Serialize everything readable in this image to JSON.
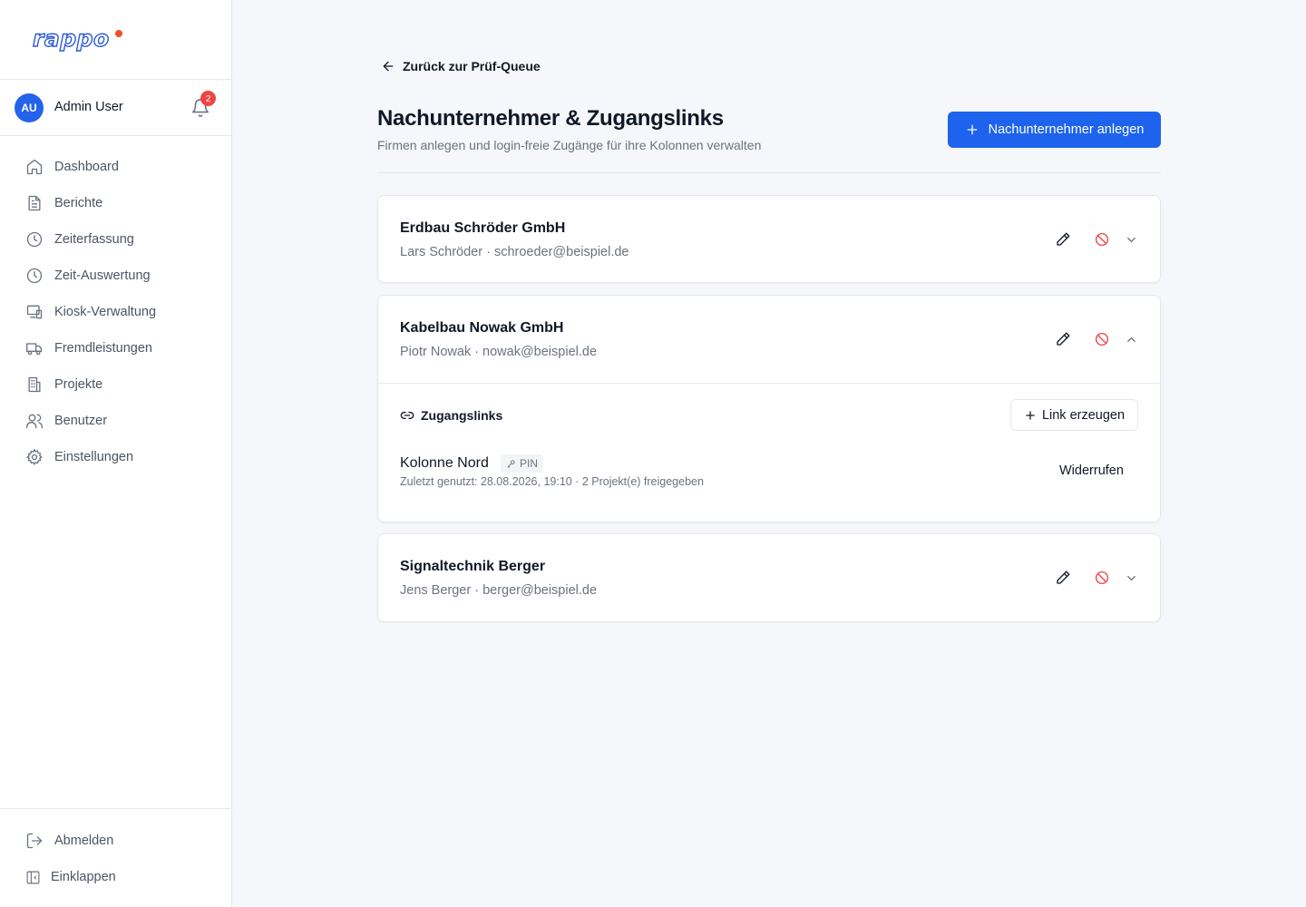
{
  "brand": {
    "logo_text": "rappo",
    "dot_color": "#f04e23"
  },
  "user": {
    "initials": "AU",
    "name": "Admin User",
    "notifications": "2"
  },
  "nav": {
    "items": [
      {
        "label": "Dashboard",
        "icon": "home-icon"
      },
      {
        "label": "Berichte",
        "icon": "document-icon"
      },
      {
        "label": "Zeiterfassung",
        "icon": "clock-icon"
      },
      {
        "label": "Zeit-Auswertung",
        "icon": "clock-icon"
      },
      {
        "label": "Kiosk-Verwaltung",
        "icon": "devices-icon"
      },
      {
        "label": "Fremdleistungen",
        "icon": "truck-icon"
      },
      {
        "label": "Projekte",
        "icon": "building-icon"
      },
      {
        "label": "Benutzer",
        "icon": "users-icon"
      },
      {
        "label": "Einstellungen",
        "icon": "gear-icon"
      }
    ],
    "bottom": [
      {
        "label": "Abmelden",
        "icon": "logout-icon"
      },
      {
        "label": "Einklappen",
        "icon": "collapse-icon"
      }
    ]
  },
  "page": {
    "back_label": "Zurück zur Prüf-Queue",
    "title": "Nachunternehmer & Zugangslinks",
    "subtitle": "Firmen anlegen und login-freie Zugänge für ihre Kolonnen verwalten",
    "create_button": "Nachunternehmer anlegen"
  },
  "subcontractors": [
    {
      "name": "Erdbau Schröder GmbH",
      "contact": "Lars Schröder · schroeder@beispiel.de",
      "expanded": false
    },
    {
      "name": "Kabelbau Nowak GmbH",
      "contact": "Piotr Nowak · nowak@beispiel.de",
      "expanded": true,
      "links_label": "Zugangslinks",
      "create_link_button": "Link erzeugen",
      "links": [
        {
          "name": "Kolonne Nord",
          "badge": "PIN",
          "meta": "Zuletzt genutzt: 28.08.2026, 19:10 · 2 Projekt(e) freigegeben",
          "revoke_label": "Widerrufen"
        }
      ]
    },
    {
      "name": "Signaltechnik Berger",
      "contact": "Jens Berger · berger@beispiel.de",
      "expanded": false
    }
  ],
  "colors": {
    "primary": "#1d63ed",
    "danger": "#ef4444"
  }
}
